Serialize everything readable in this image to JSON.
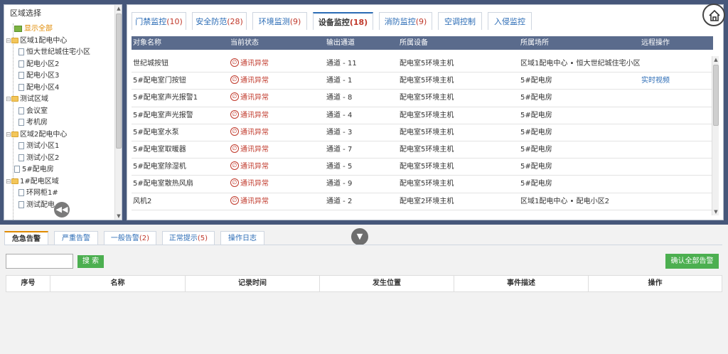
{
  "tree": {
    "title": "区域选择",
    "items": [
      {
        "label": "显示全部",
        "type": "all"
      },
      {
        "label": "区域1配电中心",
        "type": "folder"
      },
      {
        "label": "恒大世纪城住宅小区",
        "type": "doc"
      },
      {
        "label": "配电小区2",
        "type": "doc"
      },
      {
        "label": "配电小区3",
        "type": "doc"
      },
      {
        "label": "配电小区4",
        "type": "doc"
      },
      {
        "label": "测试区域",
        "type": "folder"
      },
      {
        "label": "会议室",
        "type": "doc"
      },
      {
        "label": "考机房",
        "type": "doc"
      },
      {
        "label": "区域2配电中心",
        "type": "folder"
      },
      {
        "label": "测试小区1",
        "type": "doc"
      },
      {
        "label": "测试小区2",
        "type": "doc"
      },
      {
        "label": "5#配电房",
        "type": "root-doc"
      },
      {
        "label": "1#配电区域",
        "type": "folder"
      },
      {
        "label": "环网柜1#",
        "type": "doc"
      },
      {
        "label": "测试配电",
        "type": "doc"
      }
    ]
  },
  "tabs": [
    {
      "label": "门禁监控",
      "count": "(10)"
    },
    {
      "label": "安全防范",
      "count": "(28)"
    },
    {
      "label": "环境监测",
      "count": "(9)"
    },
    {
      "label": "设备监控",
      "count": "(18)"
    },
    {
      "label": "消防监控",
      "count": "(9)"
    },
    {
      "label": "空调控制",
      "count": ""
    },
    {
      "label": "入侵监控",
      "count": ""
    }
  ],
  "table": {
    "headers": [
      "对象名称",
      "当前状态",
      "输出通道",
      "所属设备",
      "所属场所",
      "远程操作"
    ],
    "rows": [
      [
        "世纪城按钮",
        "通讯异常",
        "通道 - 11",
        "配电室5环境主机",
        "区域1配电中心 • 恒大世纪城住宅小区",
        ""
      ],
      [
        "5#配电室门按钮",
        "通讯异常",
        "通道 - 1",
        "配电室5环境主机",
        "5#配电房",
        "实时视频"
      ],
      [
        "5#配电室声光报警1",
        "通讯异常",
        "通道 - 8",
        "配电室5环境主机",
        "5#配电房",
        ""
      ],
      [
        "5#配电室声光报警",
        "通讯异常",
        "通道 - 4",
        "配电室5环境主机",
        "5#配电房",
        ""
      ],
      [
        "5#配电室水泵",
        "通讯异常",
        "通道 - 3",
        "配电室5环境主机",
        "5#配电房",
        ""
      ],
      [
        "5#配电室取暖器",
        "通讯异常",
        "通道 - 7",
        "配电室5环境主机",
        "5#配电房",
        ""
      ],
      [
        "5#配电室除湿机",
        "通讯异常",
        "通道 - 5",
        "配电室5环境主机",
        "5#配电房",
        ""
      ],
      [
        "5#配电室散热风扇",
        "通讯异常",
        "通道 - 9",
        "配电室5环境主机",
        "5#配电房",
        ""
      ],
      [
        "风机2",
        "通讯异常",
        "通道 - 2",
        "配电室2环境主机",
        "区域1配电中心 • 配电小区2",
        ""
      ]
    ]
  },
  "bottom": {
    "tabs": [
      {
        "label": "危急告警",
        "count": ""
      },
      {
        "label": "严重告警",
        "count": ""
      },
      {
        "label": "一般告警",
        "count": "(2)"
      },
      {
        "label": "正常提示",
        "count": "(5)"
      },
      {
        "label": "操作日志",
        "count": ""
      }
    ],
    "search_button": "搜 索",
    "search_value": "",
    "confirm_button": "确认全部告警",
    "headers": [
      "序号",
      "名称",
      "记录时间",
      "发生位置",
      "事件描述",
      "操作"
    ]
  },
  "colors": {
    "frame": "#46577a",
    "accent": "#2a6bb5",
    "alert": "#c0392b",
    "button": "#4caf50"
  }
}
